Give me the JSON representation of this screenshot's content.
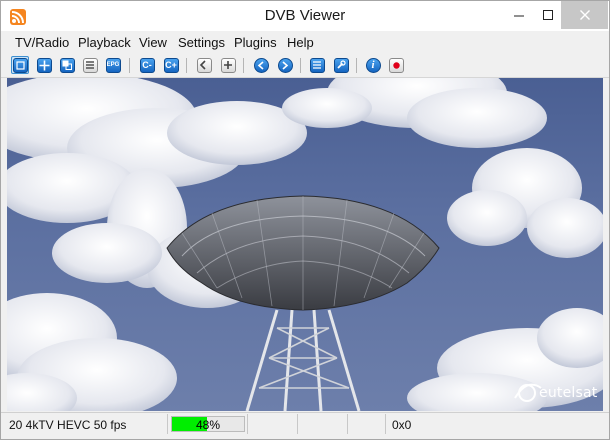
{
  "window": {
    "title": "DVB Viewer"
  },
  "menu": [
    "TV/Radio",
    "Playback",
    "View",
    "Settings",
    "Plugins",
    "Help"
  ],
  "toolbar": {
    "buttons": [
      {
        "name": "fullscreen-icon",
        "active": true
      },
      {
        "name": "move-window-icon"
      },
      {
        "name": "picture-in-picture-icon"
      },
      {
        "name": "teletext-icon"
      },
      {
        "name": "epg-icon",
        "label": "EPG"
      },
      {
        "name": "channel-down-icon",
        "label": "C-"
      },
      {
        "name": "channel-up-icon",
        "label": "C+"
      },
      {
        "name": "favorites-back-icon"
      },
      {
        "name": "favorites-add-icon"
      },
      {
        "name": "previous-icon"
      },
      {
        "name": "next-icon"
      },
      {
        "name": "channel-list-icon"
      },
      {
        "name": "settings-wrench-icon"
      },
      {
        "name": "info-icon",
        "label": "i"
      },
      {
        "name": "record-icon"
      }
    ]
  },
  "video": {
    "overlay_logo": "eutelsat",
    "content": "satellite dish against cloudy sky"
  },
  "status": {
    "channel_info": "20 4kTV HEVC 50 fps",
    "signal_percent": 48,
    "signal_label": "48%",
    "coordinates": "0x0"
  },
  "colors": {
    "signal_bar": "#00ee00",
    "record": "#e0001a",
    "title_close_bg": "#c7c7c7"
  }
}
